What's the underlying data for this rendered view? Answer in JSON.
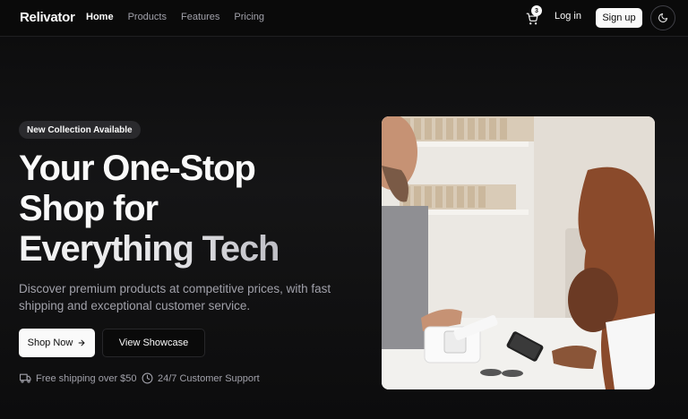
{
  "header": {
    "brand": "Relivator",
    "nav": [
      {
        "label": "Home",
        "active": true
      },
      {
        "label": "Products",
        "active": false
      },
      {
        "label": "Features",
        "active": false
      },
      {
        "label": "Pricing",
        "active": false
      }
    ],
    "cart_count": "3",
    "login_label": "Log in",
    "signup_label": "Sign up",
    "icons": {
      "cart": "shopping-cart-icon",
      "theme": "moon-icon"
    }
  },
  "hero": {
    "badge": "New Collection Available",
    "headline": {
      "line1": "Your One-Stop",
      "line2": "Shop for",
      "line3": "Everything Tech"
    },
    "subtitle": "Discover premium products at competitive prices, with fast shipping and exceptional customer service.",
    "primary_button": "Shop Now",
    "secondary_button": "View Showcase",
    "features": [
      {
        "icon": "truck-icon",
        "label": "Free shipping over $50"
      },
      {
        "icon": "clock-icon",
        "label": "24/7 Customer Support"
      }
    ]
  },
  "colors": {
    "background": "#0a0a0a",
    "foreground": "#fafafa",
    "muted": "#a1a1aa",
    "border": "#27272a"
  }
}
